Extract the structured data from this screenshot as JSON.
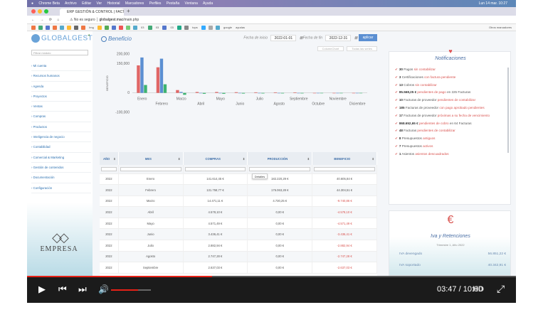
{
  "macbar": {
    "apple": "",
    "items": [
      "Chrome Beta",
      "Archivo",
      "Editar",
      "Ver",
      "Historial",
      "Marcadores",
      "Perfiles",
      "Pestaña",
      "Ventana",
      "Ayuda"
    ],
    "clock": "Lun 14 mar. 10:27"
  },
  "browser": {
    "tab_title": "ERP GESTIÓN & CONTROL | FACT",
    "new_tab": "+",
    "secure_label": "No es seguro",
    "url_host": "globalgest.mac",
    "url_path": "/main.php",
    "bookmarks": [
      "Img",
      "03",
      "03",
      "03",
      "tops",
      "google",
      "ayudas"
    ],
    "other_bookmarks": "Otros marcadores"
  },
  "sidebar": {
    "logo": "GLOBALGEST",
    "filter_placeholder": "Filtrar módulo",
    "items": [
      "Mi cuenta",
      "Recursos humanos",
      "Agenda",
      "Proyectos",
      "Ventas",
      "Compras",
      "Productos",
      "Inteligencia de negocio",
      "Contabilidad",
      "Comercial & Marketing",
      "Gestión de contenidos",
      "Documentación",
      "Configuración"
    ],
    "brand": "EMPRESA"
  },
  "page": {
    "title": "Beneficio",
    "start_label": "Fecha de inicio",
    "start_value": "2022-01-01",
    "end_label": "Fecha de fin",
    "end_value": "2022-12-31",
    "apply": "aplicar",
    "chart_type": "ColumnChart",
    "chart_filter": "Todas las series"
  },
  "chart_data": {
    "type": "bar",
    "categories": [
      "Enero",
      "Febrero",
      "Marzo",
      "Abril",
      "Mayo",
      "Junio",
      "Julio",
      "Agosto",
      "Septiembre",
      "Octubre",
      "Noviembre",
      "Diciembre"
    ],
    "series": [
      {
        "name": "Compras",
        "values": [
          141614.45,
          131758.77,
          14471.11,
          4578.1,
          4571.49,
          3436.41,
          2882.94,
          2747.28,
          2637,
          0,
          0,
          0
        ],
        "color": "#e06666"
      },
      {
        "name": "Producción",
        "values": [
          182220.29,
          176063.28,
          4730.25,
          0,
          0,
          0,
          0,
          0,
          0,
          0,
          0,
          0
        ],
        "color": "#5b8fd2"
      },
      {
        "name": "Beneficio",
        "values": [
          40605.84,
          44304.51,
          -9740.86,
          -4578.1,
          -4571.49,
          -3436.41,
          -2882.94,
          -2747.28,
          -2637,
          0,
          0,
          0
        ],
        "color": "#3cb371"
      }
    ],
    "ylabel": "BENEFICIO",
    "yticks": [
      200000,
      150000,
      0,
      -100000
    ],
    "ytick_labels": [
      "200,000",
      "150,000",
      "0",
      "-100,000"
    ],
    "ylim": [
      -100000,
      200000
    ],
    "legend": "none"
  },
  "table": {
    "headers": [
      "AÑO",
      "MES",
      "COMPRAS",
      "PRODUCCIÓN",
      "BENEFICIO"
    ],
    "sort_icon": "⬍",
    "rows": [
      [
        "2022",
        "Enero",
        "141.614,45 €",
        "182.220,29 €",
        "40.605,84 €"
      ],
      [
        "2022",
        "Febrero",
        "131.758,77 €",
        "176.063,28 €",
        "44.304,51 €"
      ],
      [
        "2022",
        "Marzo",
        "14.471,11 €",
        "4.730,25 €",
        "-9.740,86 €"
      ],
      [
        "2022",
        "Abril",
        "4.578,10 €",
        "0,00 €",
        "-4.578,10 €"
      ],
      [
        "2022",
        "Mayo",
        "4.571,49 €",
        "0,00 €",
        "-4.571,49 €"
      ],
      [
        "2022",
        "Junio",
        "3.436,41 €",
        "0,00 €",
        "-3.436,41 €"
      ],
      [
        "2022",
        "Julio",
        "2.882,94 €",
        "0,00 €",
        "-2.882,94 €"
      ],
      [
        "2022",
        "Agosto",
        "2.747,28 €",
        "0,00 €",
        "-2.747,28 €"
      ],
      [
        "2022",
        "Septiembre",
        "2.637,03 €",
        "0,00 €",
        "-2.637,03 €"
      ]
    ],
    "tooltip": "Detalles"
  },
  "notifications": {
    "title": "Notificaciones",
    "items": [
      {
        "n": "30",
        "pre": "Pagos",
        "hl": "sin contabilizar",
        "post": ""
      },
      {
        "n": "3",
        "pre": "Certificaciones",
        "hl": "con factura pendiente",
        "post": ""
      },
      {
        "n": "13",
        "pre": "Cobros",
        "hl": "sin contabilizar",
        "post": ""
      },
      {
        "n": "85.568,25 €",
        "pre": "",
        "hl": "pendientes de pago",
        "post": "en 225 Facturas"
      },
      {
        "n": "10",
        "pre": "Facturas de proveedor",
        "hl": "pendientes de contabilizar",
        "post": ""
      },
      {
        "n": "185",
        "pre": "Facturas de proveedor",
        "hl": "con pago aprobado pendientes",
        "post": ""
      },
      {
        "n": "17",
        "pre": "Facturas de proveedor",
        "hl": "próximas a su fecha de vencimiento",
        "post": ""
      },
      {
        "n": "868.652,65 €",
        "pre": "",
        "hl": "pendientes de cobro",
        "post": "en 64 Facturas"
      },
      {
        "n": "48",
        "pre": "Facturas",
        "hl": "pendientes de contabilizar",
        "post": ""
      },
      {
        "n": "8",
        "pre": "Presupuestos",
        "hl": "antiguos",
        "post": ""
      },
      {
        "n": "7",
        "pre": "Presupuestos",
        "hl": "activos",
        "post": ""
      },
      {
        "n": "1",
        "pre": "Asientos",
        "hl": "asientos descuadrados",
        "post": ""
      }
    ]
  },
  "iva": {
    "symbol": "€",
    "title": "Iva y Retenciones",
    "subtitle": "Trimestre 1, Año 2022",
    "devengado_label": "IVA devengado",
    "devengado_value": "56.851,22 €",
    "soportado_label": "IVA soportado",
    "soportado_value": "40.342,91 €"
  },
  "player": {
    "time": "03:47 / 10:00",
    "hd": "HD",
    "progress": 0.378,
    "volume": 0.68
  },
  "colors": {
    "accent": "#5b8fd2",
    "danger": "#d9534f",
    "progress": "#e62117"
  }
}
